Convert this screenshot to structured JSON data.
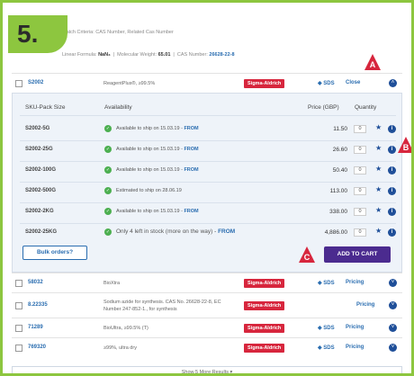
{
  "step_label": "5.",
  "header": {
    "criteria_text": "Match Criteria: CAS Number, Related Cas Number",
    "linear_formula_label": "Linear Formula:",
    "linear_formula_value": "NaN₃",
    "mw_label": "Molecular Weight:",
    "mw_value": "65.01",
    "cas_label": "CAS Number:",
    "cas_value": "26628-22-8"
  },
  "main_product": {
    "number": "S2002",
    "description": "ReagentPlus®, ≥99.5%",
    "brand": "Sigma-Aldrich",
    "sds_label": "SDS",
    "close_label": "Close"
  },
  "sku_table": {
    "headers": {
      "sku": "SKU-Pack Size",
      "availability": "Availability",
      "price": "Price (GBP)",
      "quantity": "Quantity"
    },
    "rows": [
      {
        "sku": "S2002-5G",
        "availability": "Available to ship on 15.03.19 - ",
        "from": "FROM",
        "price": "11.50",
        "qty": "0"
      },
      {
        "sku": "S2002-25G",
        "availability": "Available to ship on 15.03.19 - ",
        "from": "FROM",
        "price": "26.60",
        "qty": "0"
      },
      {
        "sku": "S2002-100G",
        "availability": "Available to ship on 15.03.19 - ",
        "from": "FROM",
        "price": "50.40",
        "qty": "0"
      },
      {
        "sku": "S2002-500G",
        "availability": "Estimated to ship on 28.06.19",
        "from": "",
        "price": "113.00",
        "qty": "0"
      },
      {
        "sku": "S2002-2KG",
        "availability": "Available to ship on 15.03.19 - ",
        "from": "FROM",
        "price": "338.00",
        "qty": "0"
      },
      {
        "sku": "S2002-25KG",
        "availability": "Only 4 left in stock (more on the way) - ",
        "from": "FROM",
        "price": "4,886.00",
        "qty": "0"
      }
    ]
  },
  "actions": {
    "bulk_label": "Bulk orders?",
    "add_label": "ADD TO CART"
  },
  "markers": {
    "a": "A",
    "b": "B",
    "c": "C"
  },
  "other_products": [
    {
      "number": "58032",
      "description": "BioXtra",
      "brand": "Sigma-Aldrich",
      "sds": "SDS",
      "action": "Pricing"
    },
    {
      "number": "8.22335",
      "description": "Sodium azide for synthesis. CAS No. 26628-22-8, EC Number 247-852-1., for synthesis",
      "brand": "Sigma-Aldrich",
      "sds": "",
      "action": "Pricing"
    },
    {
      "number": "71289",
      "description": "BioUltra, ≥99.5% (T)",
      "brand": "Sigma-Aldrich",
      "sds": "SDS",
      "action": "Pricing"
    },
    {
      "number": "769320",
      "description": "≥99%, ultra dry",
      "brand": "Sigma-Aldrich",
      "sds": "SDS",
      "action": "Pricing"
    }
  ],
  "show_more": "Show 5 More Results ▾",
  "colors": {
    "accent": "#8dc63f",
    "brand_red": "#d7263d",
    "link_blue": "#2a6db0",
    "cart_purple": "#4b2b8f"
  }
}
